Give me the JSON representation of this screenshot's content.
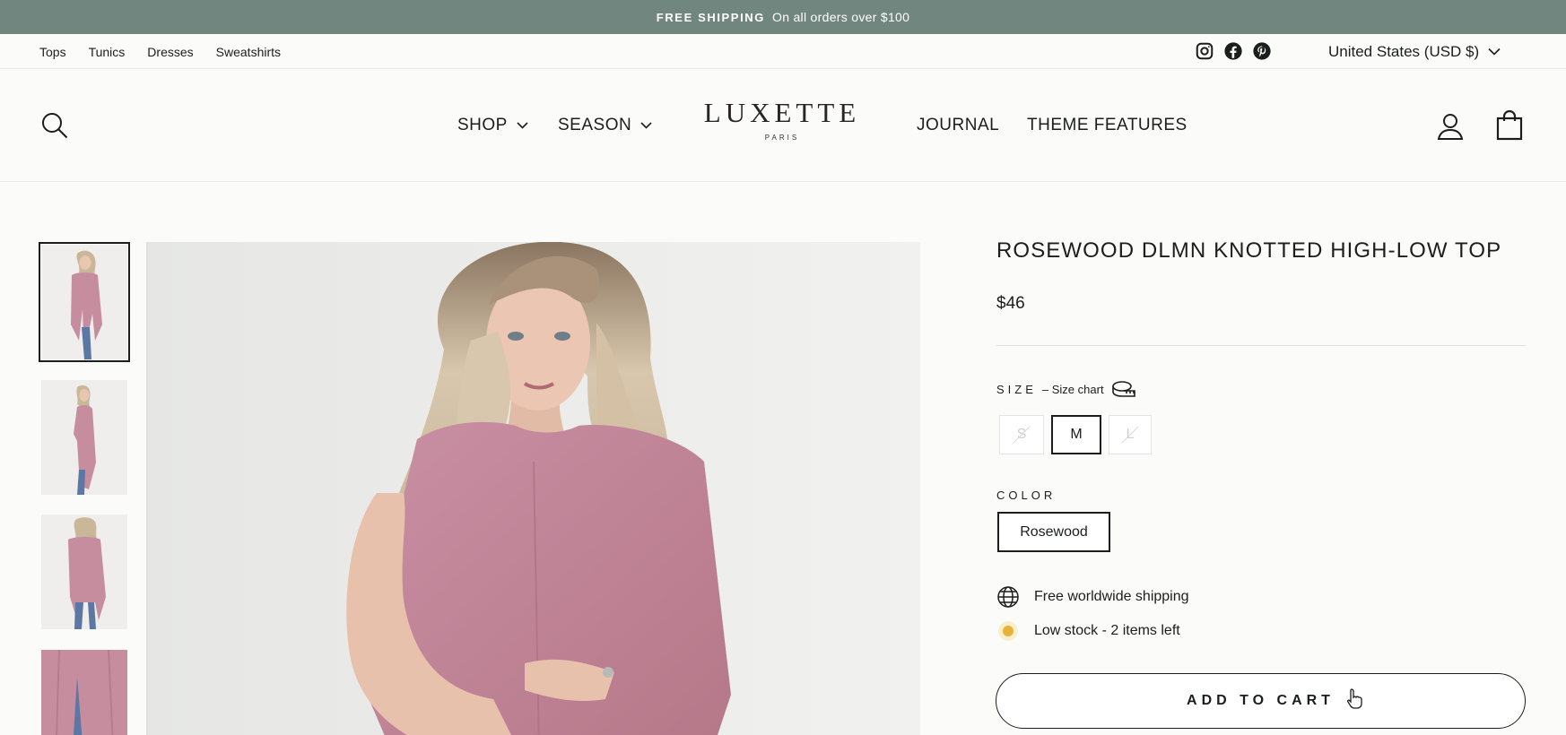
{
  "announcement": {
    "strong": "FREE SHIPPING",
    "text": "On all orders over $100",
    "bg_color": "#71867f"
  },
  "utility_nav": {
    "links": [
      "Tops",
      "Tunics",
      "Dresses",
      "Sweatshirts"
    ],
    "social_icons": [
      "instagram-icon",
      "facebook-icon",
      "pinterest-icon"
    ],
    "currency": "United States (USD $)"
  },
  "header": {
    "nav_left": [
      "SHOP",
      "SEASON"
    ],
    "logo": {
      "word": "LUXETTE",
      "sub": "PARIS"
    },
    "nav_right": [
      "JOURNAL",
      "THEME FEATURES"
    ],
    "icons": [
      "search-icon",
      "account-icon",
      "cart-icon"
    ]
  },
  "gallery": {
    "thumbnail_count": 4,
    "selected_index": 0
  },
  "product": {
    "title": "ROSEWOOD DLMN KNOTTED HIGH-LOW TOP",
    "price": "$46",
    "size_label": "SIZE",
    "size_chart": "– Size chart",
    "sizes": [
      {
        "label": "S",
        "available": false
      },
      {
        "label": "M",
        "available": true,
        "selected": true
      },
      {
        "label": "L",
        "available": false
      }
    ],
    "color_label": "COLOR",
    "color_value": "Rosewood",
    "shipping_note": "Free worldwide shipping",
    "stock_note": "Low stock - 2 items left",
    "stock_dot_color": "#e8b33a",
    "add_to_cart": "ADD TO CART"
  }
}
